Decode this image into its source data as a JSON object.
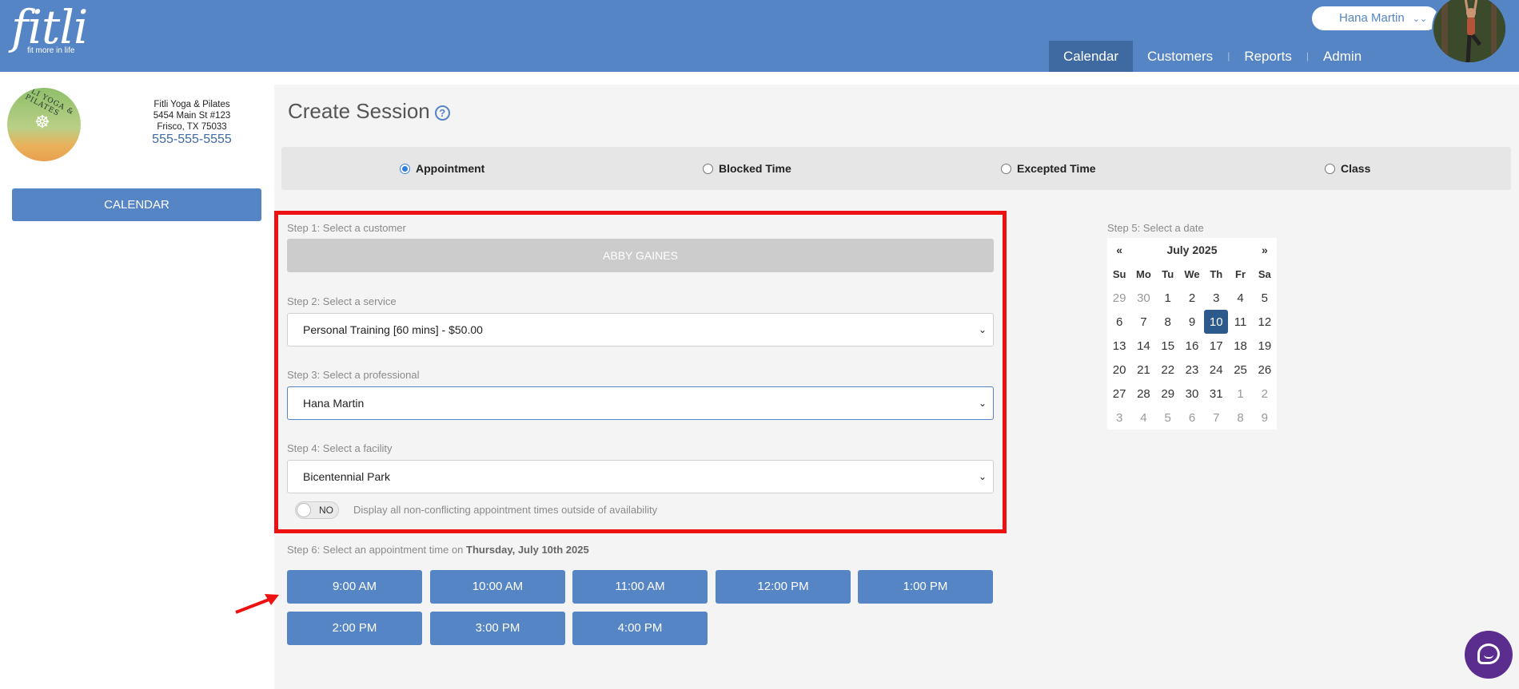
{
  "header": {
    "brand": "fitli",
    "tagline": "fit more in life",
    "user_name": "Hana Martin",
    "nav": [
      {
        "label": "Calendar",
        "active": true
      },
      {
        "label": "Customers",
        "active": false
      },
      {
        "label": "Reports",
        "active": false
      },
      {
        "label": "Admin",
        "active": false
      }
    ]
  },
  "sidebar": {
    "business_name": "Fitli Yoga & Pilates",
    "address_line1": "5454 Main St #123",
    "address_line2": "Frisco, TX 75033",
    "phone": "555-555-5555",
    "calendar_button": "CALENDAR"
  },
  "page": {
    "title": "Create Session",
    "session_types": [
      {
        "label": "Appointment",
        "checked": true
      },
      {
        "label": "Blocked Time",
        "checked": false
      },
      {
        "label": "Excepted Time",
        "checked": false
      },
      {
        "label": "Class",
        "checked": false
      }
    ]
  },
  "steps": {
    "step1_label": "Step 1: Select a customer",
    "customer": "ABBY GAINES",
    "step2_label": "Step 2: Select a service",
    "service": "Personal Training [60 mins] - $50.00",
    "step3_label": "Step 3: Select a professional",
    "professional": "Hana Martin",
    "step4_label": "Step 4: Select a facility",
    "facility": "Bicentennial Park",
    "toggle_state": "NO",
    "toggle_text": "Display all non-conflicting appointment times outside of availability",
    "step5_label": "Step 5: Select a date",
    "step6_prefix": "Step 6: Select an appointment time on",
    "step6_date": "Thursday, July 10th 2025"
  },
  "time_slots": [
    "9:00 AM",
    "10:00 AM",
    "11:00 AM",
    "12:00 PM",
    "1:00 PM",
    "2:00 PM",
    "3:00 PM",
    "4:00 PM"
  ],
  "calendar": {
    "prev": "«",
    "next": "»",
    "month_label": "July 2025",
    "weekdays": [
      "Su",
      "Mo",
      "Tu",
      "We",
      "Th",
      "Fr",
      "Sa"
    ],
    "weeks": [
      [
        "29",
        "30",
        "1",
        "2",
        "3",
        "4",
        "5"
      ],
      [
        "6",
        "7",
        "8",
        "9",
        "10",
        "11",
        "12"
      ],
      [
        "13",
        "14",
        "15",
        "16",
        "17",
        "18",
        "19"
      ],
      [
        "20",
        "21",
        "22",
        "23",
        "24",
        "25",
        "26"
      ],
      [
        "27",
        "28",
        "29",
        "30",
        "31",
        "1",
        "2"
      ],
      [
        "3",
        "4",
        "5",
        "6",
        "7",
        "8",
        "9"
      ]
    ],
    "selected_day": "10"
  },
  "colors": {
    "brand_blue": "#5585c5",
    "nav_active": "#3e6aa1",
    "highlight_red": "#ee1111",
    "chat_purple": "#5b2d8f"
  }
}
